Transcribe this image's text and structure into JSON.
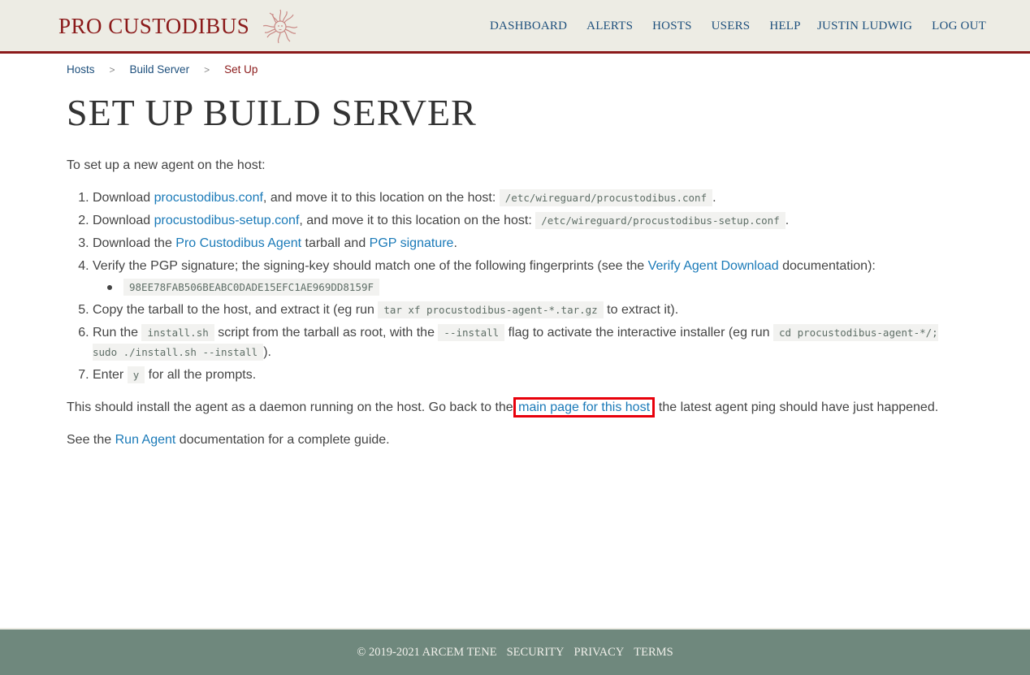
{
  "header": {
    "logo_text": "PRO CUSTODIBUS",
    "logo_icon": "medusa-head-icon",
    "nav_main": [
      "DASHBOARD",
      "ALERTS",
      "HOSTS",
      "USERS",
      "HELP"
    ],
    "nav_user": [
      "JUSTIN LUDWIG",
      "LOG OUT"
    ]
  },
  "breadcrumb": {
    "items": [
      "Hosts",
      "Build Server"
    ],
    "separator": ">",
    "current": "Set Up"
  },
  "page_title": "SET UP BUILD SERVER",
  "intro": "To set up a new agent on the host:",
  "steps": {
    "s1": {
      "pre": "Download ",
      "link": "procustodibus.conf",
      "mid": ", and move it to this location on the host: ",
      "code": "/etc/wireguard/procustodibus.conf",
      "post": "."
    },
    "s2": {
      "pre": "Download ",
      "link": "procustodibus-setup.conf",
      "mid": ", and move it to this location on the host: ",
      "code": "/etc/wireguard/procustodibus-setup.conf",
      "post": "."
    },
    "s3": {
      "pre": "Download the ",
      "link1": "Pro Custodibus Agent",
      "mid": " tarball and ",
      "link2": "PGP signature",
      "post": "."
    },
    "s4": {
      "pre": "Verify the PGP signature; the signing-key should match one of the following fingerprints (see the ",
      "link": "Verify Agent Download",
      "post": " documentation):",
      "fingerprints": [
        "98EE78FAB506BEABC0DADE15EFC1AE969DD8159F"
      ]
    },
    "s5": {
      "pre": "Copy the tarball to the host, and extract it (eg run ",
      "code": "tar xf procustodibus-agent-*.tar.gz",
      "post": " to extract it)."
    },
    "s6": {
      "pre": "Run the ",
      "code1": "install.sh",
      "mid1": " script from the tarball as root, with the ",
      "code2": "--install",
      "mid2": " flag to activate the interactive installer (eg run ",
      "code3": "cd procustodibus-agent-*/; sudo ./install.sh --install",
      "post": ")."
    },
    "s7": {
      "pre": "Enter ",
      "code": "y",
      "post": " for all the prompts."
    }
  },
  "closing": {
    "pre": "This should install the agent as a daemon running on the host. Go back to the ",
    "link": "main page for this host",
    "post": "; the latest agent ping should have just happened."
  },
  "see_also": {
    "pre": "See the ",
    "link": "Run Agent",
    "post": " documentation for a complete guide."
  },
  "footer": {
    "copyright": "© 2019-2021 ARCEM TENE",
    "links": [
      "SECURITY",
      "PRIVACY",
      "TERMS"
    ]
  },
  "colors": {
    "brand_red": "#8b1a1a",
    "nav_blue": "#1d4f7c",
    "link_blue": "#1a7ab8",
    "header_bg": "#edece4",
    "footer_bg": "#6f887d",
    "highlight": "#e8000b"
  }
}
